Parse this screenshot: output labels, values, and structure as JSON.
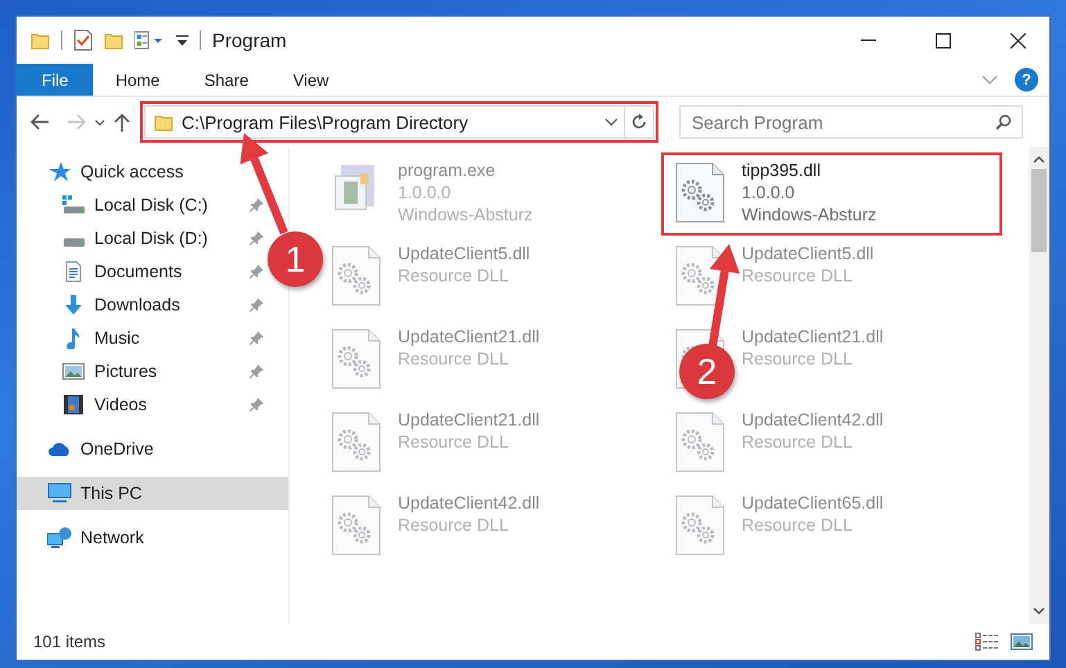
{
  "window": {
    "title": "Program"
  },
  "ribbon": {
    "tabs": [
      {
        "label": "File",
        "selected": true
      },
      {
        "label": "Home",
        "selected": false
      },
      {
        "label": "Share",
        "selected": false
      },
      {
        "label": "View",
        "selected": false
      }
    ],
    "help": "?"
  },
  "address": {
    "path": "C:\\Program Files\\Program Directory",
    "highlighted": true
  },
  "search": {
    "placeholder": "Search Program"
  },
  "sidebar": {
    "items": [
      {
        "label": "Quick access",
        "selected": false,
        "children": [
          {
            "label": "Local Disk (C:)",
            "pinned": true
          },
          {
            "label": "Local Disk (D:)",
            "pinned": true
          },
          {
            "label": "Documents",
            "pinned": true
          },
          {
            "label": "Downloads",
            "pinned": true
          },
          {
            "label": "Music",
            "pinned": true
          },
          {
            "label": "Pictures",
            "pinned": true
          },
          {
            "label": "Videos",
            "pinned": true
          }
        ]
      },
      {
        "label": "OneDrive",
        "selected": false
      },
      {
        "label": "This PC",
        "selected": true
      },
      {
        "label": "Network",
        "selected": false
      }
    ]
  },
  "files": [
    {
      "kind": "application",
      "name": "program.exe",
      "line_2": "1.0.0.0",
      "line_3": "Windows-Absturz",
      "faded": true,
      "highlighted": false
    },
    {
      "kind": "library",
      "name": "tipp395.dll",
      "line_2": "1.0.0.0",
      "line_3": "Windows-Absturz",
      "faded": false,
      "highlighted": true
    },
    {
      "kind": "library",
      "name": "UpdateClient5.dll",
      "line_2": "Resource DLL",
      "faded": true,
      "highlighted": false
    },
    {
      "kind": "library",
      "name": "UpdateClient5.dll",
      "line_2": "Resource DLL",
      "faded": true,
      "highlighted": false
    },
    {
      "kind": "library",
      "name": "UpdateClient21.dll",
      "line_2": "Resource DLL",
      "faded": true,
      "highlighted": false
    },
    {
      "kind": "library",
      "name": "UpdateClient21.dll",
      "line_2": "Resource DLL",
      "faded": true,
      "highlighted": false
    },
    {
      "kind": "library",
      "name": "UpdateClient21.dll",
      "line_2": "Resource DLL",
      "faded": true,
      "highlighted": false
    },
    {
      "kind": "library",
      "name": "UpdateClient42.dll",
      "line_2": "Resource DLL",
      "faded": true,
      "highlighted": false
    },
    {
      "kind": "library",
      "name": "UpdateClient42.dll",
      "line_2": "Resource DLL",
      "faded": true,
      "highlighted": false
    },
    {
      "kind": "library",
      "name": "UpdateClient65.dll",
      "line_2": "Resource DLL",
      "faded": true,
      "highlighted": false
    }
  ],
  "status_bar": {
    "count": "101 items"
  },
  "callouts": [
    {
      "label": "1"
    },
    {
      "label": "2"
    }
  ]
}
